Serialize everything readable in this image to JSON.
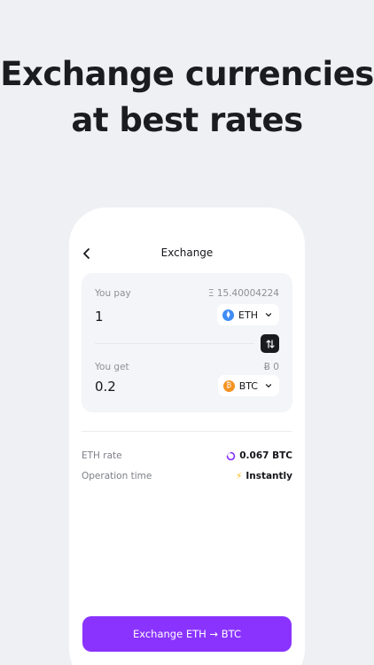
{
  "headline": {
    "line1": "Exchange currencies",
    "line2": "at best rates"
  },
  "nav": {
    "title": "Exchange"
  },
  "pay": {
    "label": "You pay",
    "balance": "Ξ 15.40004224",
    "amount": "1",
    "coin": "ETH",
    "coin_symbol": "⧫",
    "coin_color": "#3f8cf5"
  },
  "get": {
    "label": "You get",
    "balance": "Ƀ 0",
    "amount": "0.2",
    "coin": "BTC",
    "coin_symbol": "₿",
    "coin_color": "#f39322"
  },
  "info": {
    "rate_label": "ETH rate",
    "rate_value": "0.067 BTC",
    "time_label": "Operation time",
    "time_value": "Instantly",
    "time_icon": "⚡"
  },
  "cta": {
    "label": "Exchange ETH → BTC",
    "color": "#8a33ff"
  }
}
